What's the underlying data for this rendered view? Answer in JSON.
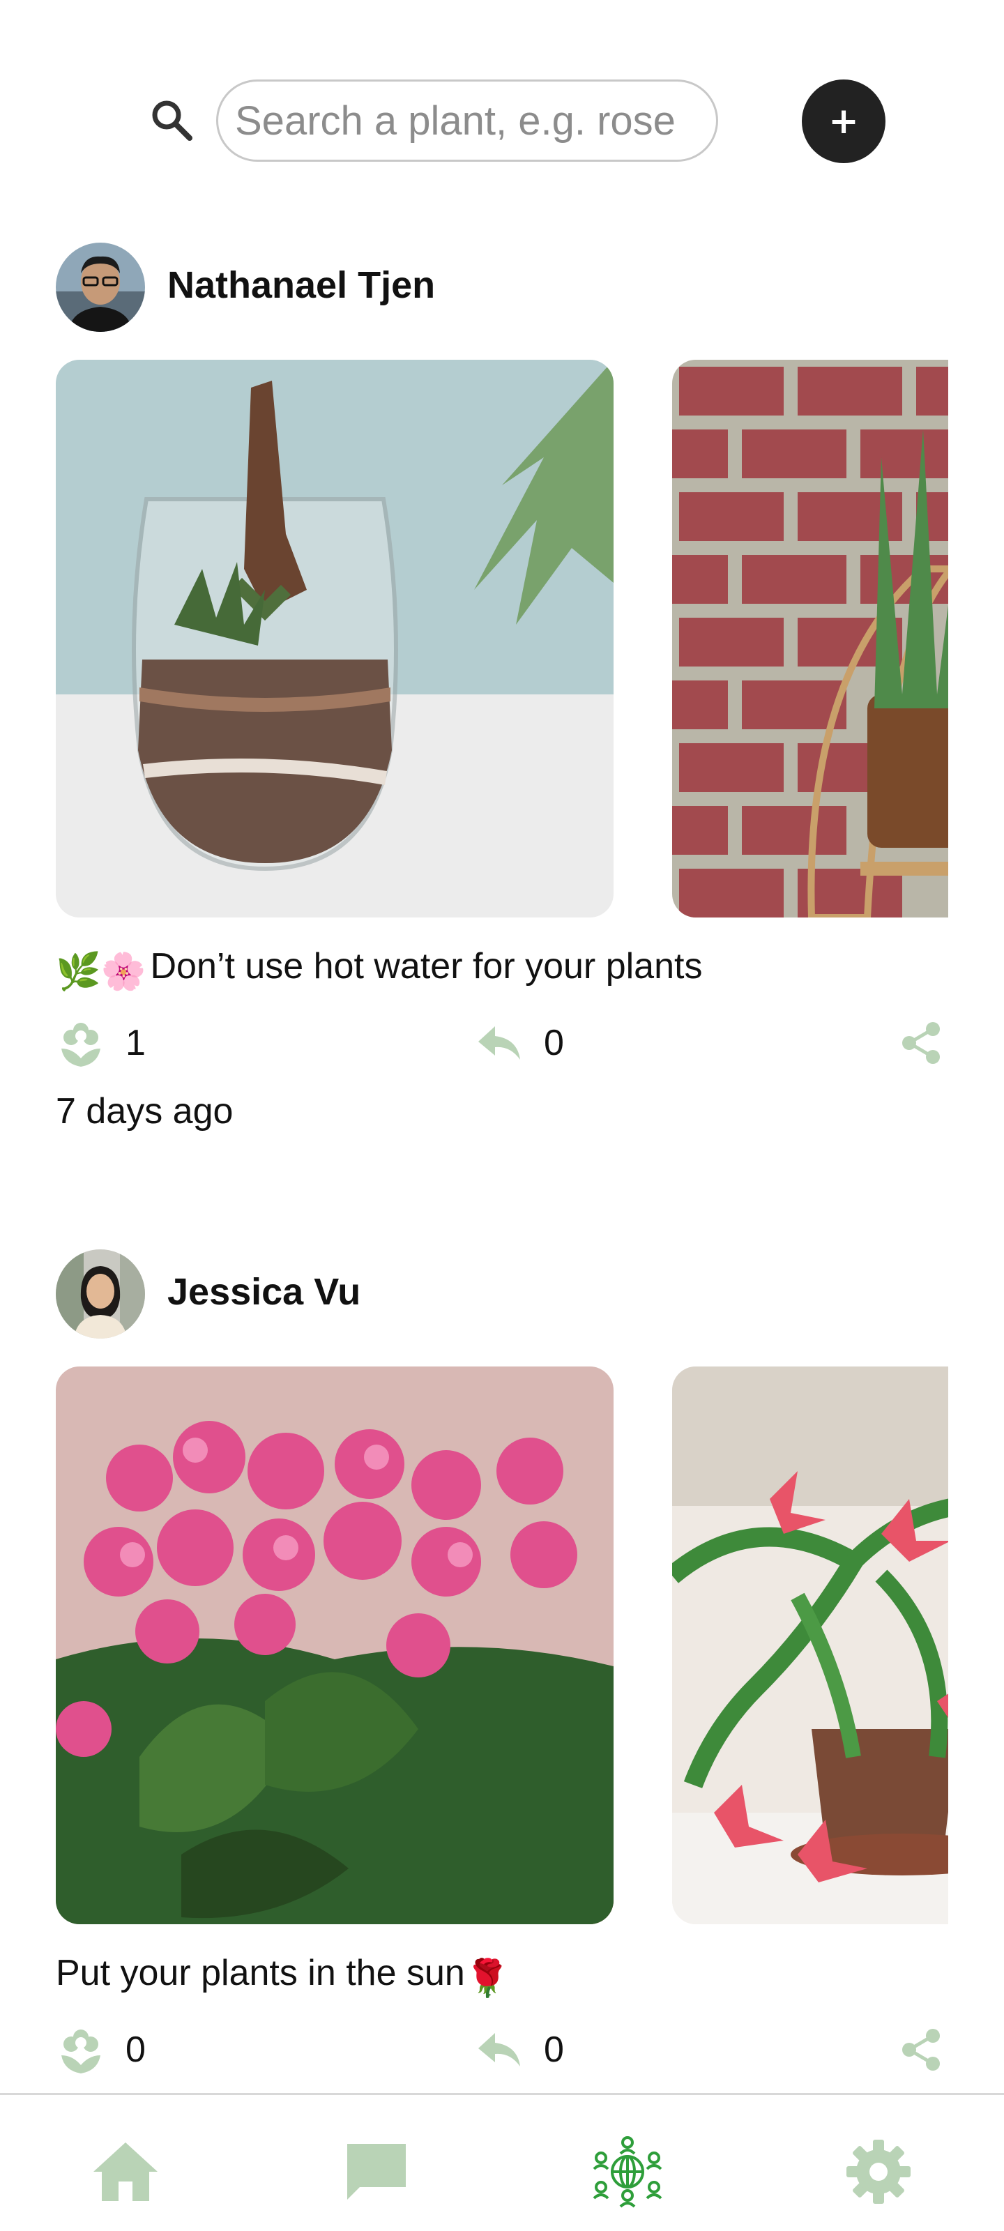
{
  "colors": {
    "accent": "#2e9e3a",
    "icon_muted": "#b9d3b6",
    "button_dark": "#222222"
  },
  "search": {
    "icon": "search-icon",
    "placeholder": "Search a plant, e.g. rose",
    "value": ""
  },
  "add_button": {
    "label": "+",
    "icon": "plus-icon"
  },
  "posts": [
    {
      "author": "Nathanael Tjen",
      "photos": [
        "terrarium-photo",
        "aloe-on-brick-wall-photo"
      ],
      "caption_emojis": "🌿🌸",
      "caption": "Don’t use hot water for your plants",
      "likes": "1",
      "replies": "0",
      "timestamp": "7 days ago"
    },
    {
      "author": "Jessica Vu",
      "photos": [
        "pink-kalanchoe-photo",
        "christmas-cactus-photo"
      ],
      "caption": "Put your plants in the sun",
      "caption_emojis": "🌹",
      "likes": "0",
      "replies": "0"
    }
  ],
  "nav": {
    "items": [
      {
        "name": "home",
        "icon": "home-icon",
        "active": false
      },
      {
        "name": "chat",
        "icon": "chat-icon",
        "active": false
      },
      {
        "name": "community",
        "icon": "community-globe-icon",
        "active": true
      },
      {
        "name": "settings",
        "icon": "gear-icon",
        "active": false
      }
    ]
  }
}
